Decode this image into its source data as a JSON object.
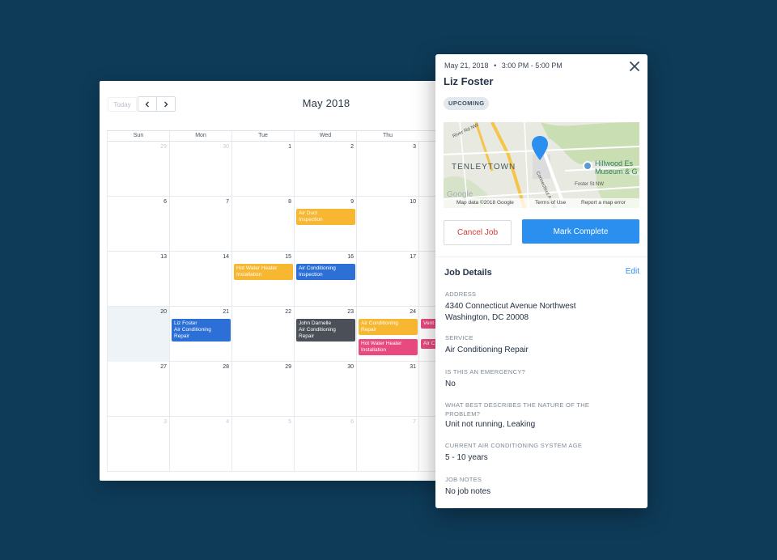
{
  "calendar": {
    "today_label": "Today",
    "prev_icon": "chevron-left-icon",
    "next_icon": "chevron-right-icon",
    "month_title": "May 2018",
    "weekdays": [
      "Sun",
      "Mon",
      "Tue",
      "Wed",
      "Thu"
    ],
    "weeks": [
      [
        {
          "n": "29",
          "other": true
        },
        {
          "n": "30",
          "other": true
        },
        {
          "n": "1"
        },
        {
          "n": "2"
        },
        {
          "n": "3"
        }
      ],
      [
        {
          "n": "6"
        },
        {
          "n": "7"
        },
        {
          "n": "8"
        },
        {
          "n": "9"
        },
        {
          "n": "10"
        }
      ],
      [
        {
          "n": "13"
        },
        {
          "n": "14"
        },
        {
          "n": "15"
        },
        {
          "n": "16"
        },
        {
          "n": "17"
        }
      ],
      [
        {
          "n": "20",
          "today": true
        },
        {
          "n": "21"
        },
        {
          "n": "22"
        },
        {
          "n": "23"
        },
        {
          "n": "24"
        }
      ],
      [
        {
          "n": "27"
        },
        {
          "n": "28"
        },
        {
          "n": "29"
        },
        {
          "n": "30"
        },
        {
          "n": "31"
        }
      ],
      [
        {
          "n": "3",
          "other": true
        },
        {
          "n": "4",
          "other": true
        },
        {
          "n": "5",
          "other": true
        },
        {
          "n": "6",
          "other": true
        },
        {
          "n": "7",
          "other": true
        }
      ]
    ],
    "events": [
      {
        "week": 1,
        "day": 3,
        "slot": 0,
        "lines": [
          "Air Duct",
          "Inspection"
        ],
        "color": "yellow"
      },
      {
        "week": 2,
        "day": 2,
        "slot": 0,
        "lines": [
          "Hot Water Heater",
          "Installation"
        ],
        "color": "yellow"
      },
      {
        "week": 2,
        "day": 3,
        "slot": 0,
        "lines": [
          "Air Conditioning",
          "Inspection"
        ],
        "color": "blue"
      },
      {
        "week": 3,
        "day": 1,
        "slot": 0,
        "lines": [
          "Liz Foster",
          "Air Conditioning",
          "Repair"
        ],
        "color": "blue"
      },
      {
        "week": 3,
        "day": 3,
        "slot": 0,
        "lines": [
          "John Darnelle",
          "Air Conditioning",
          "Repair"
        ],
        "color": "dark"
      },
      {
        "week": 3,
        "day": 4,
        "slot": 0,
        "lines": [
          "Air Conditioning",
          "Repair"
        ],
        "color": "yellow"
      },
      {
        "week": 3,
        "day": 4,
        "slot": 1,
        "lines": [
          "Hot Water Heater",
          "Installation"
        ],
        "color": "pink"
      },
      {
        "week": 3,
        "day": 5,
        "slot": 0,
        "lines": [
          "Vent"
        ],
        "color": "pink"
      },
      {
        "week": 3,
        "day": 5,
        "slot": 1,
        "lines": [
          "Air C"
        ],
        "color": "pink"
      }
    ]
  },
  "panel": {
    "date": "May 21, 2018",
    "time_sep": "•",
    "time": "3:00 PM - 5:00 PM",
    "close_icon": "close-icon",
    "customer_name": "Liz Foster",
    "status_badge": "UPCOMING",
    "map": {
      "neighborhood": "TENLEYTOWN",
      "poi_line1": "Hillwood Es",
      "poi_line2": "Museum & G",
      "road1": "River Rd NW",
      "road2": "Connecticut Ave NW",
      "road3": "Foster St NW",
      "attribution": "Map data ©2018 Google",
      "terms": "Terms of Use",
      "report": "Report a map error",
      "logo": "Google"
    },
    "cancel_label": "Cancel Job",
    "complete_label": "Mark Complete",
    "section_title": "Job Details",
    "edit_label": "Edit",
    "fields": [
      {
        "label": "ADDRESS",
        "value_lines": [
          "4340 Connecticut Avenue Northwest",
          "Washington, DC 20008"
        ]
      },
      {
        "label": "SERVICE",
        "value_lines": [
          "Air Conditioning Repair"
        ]
      },
      {
        "label": "IS THIS AN EMERGENCY?",
        "value_lines": [
          "No"
        ]
      },
      {
        "label": "WHAT BEST DESCRIBES THE NATURE OF THE PROBLEM?",
        "value_lines": [
          "Unit not running, Leaking"
        ]
      },
      {
        "label": "CURRENT AIR CONDITIONING SYSTEM AGE",
        "value_lines": [
          "5 - 10 years"
        ]
      },
      {
        "label": "JOB NOTES",
        "value_lines": [
          "No job notes"
        ]
      }
    ]
  },
  "colors": {
    "background": "#0e3b58",
    "primary": "#2b8ff0",
    "danger": "#d23b3b",
    "event_yellow": "#f7b731",
    "event_blue": "#2c6fd6",
    "event_dark": "#4b5058",
    "event_pink": "#e84a7f"
  }
}
